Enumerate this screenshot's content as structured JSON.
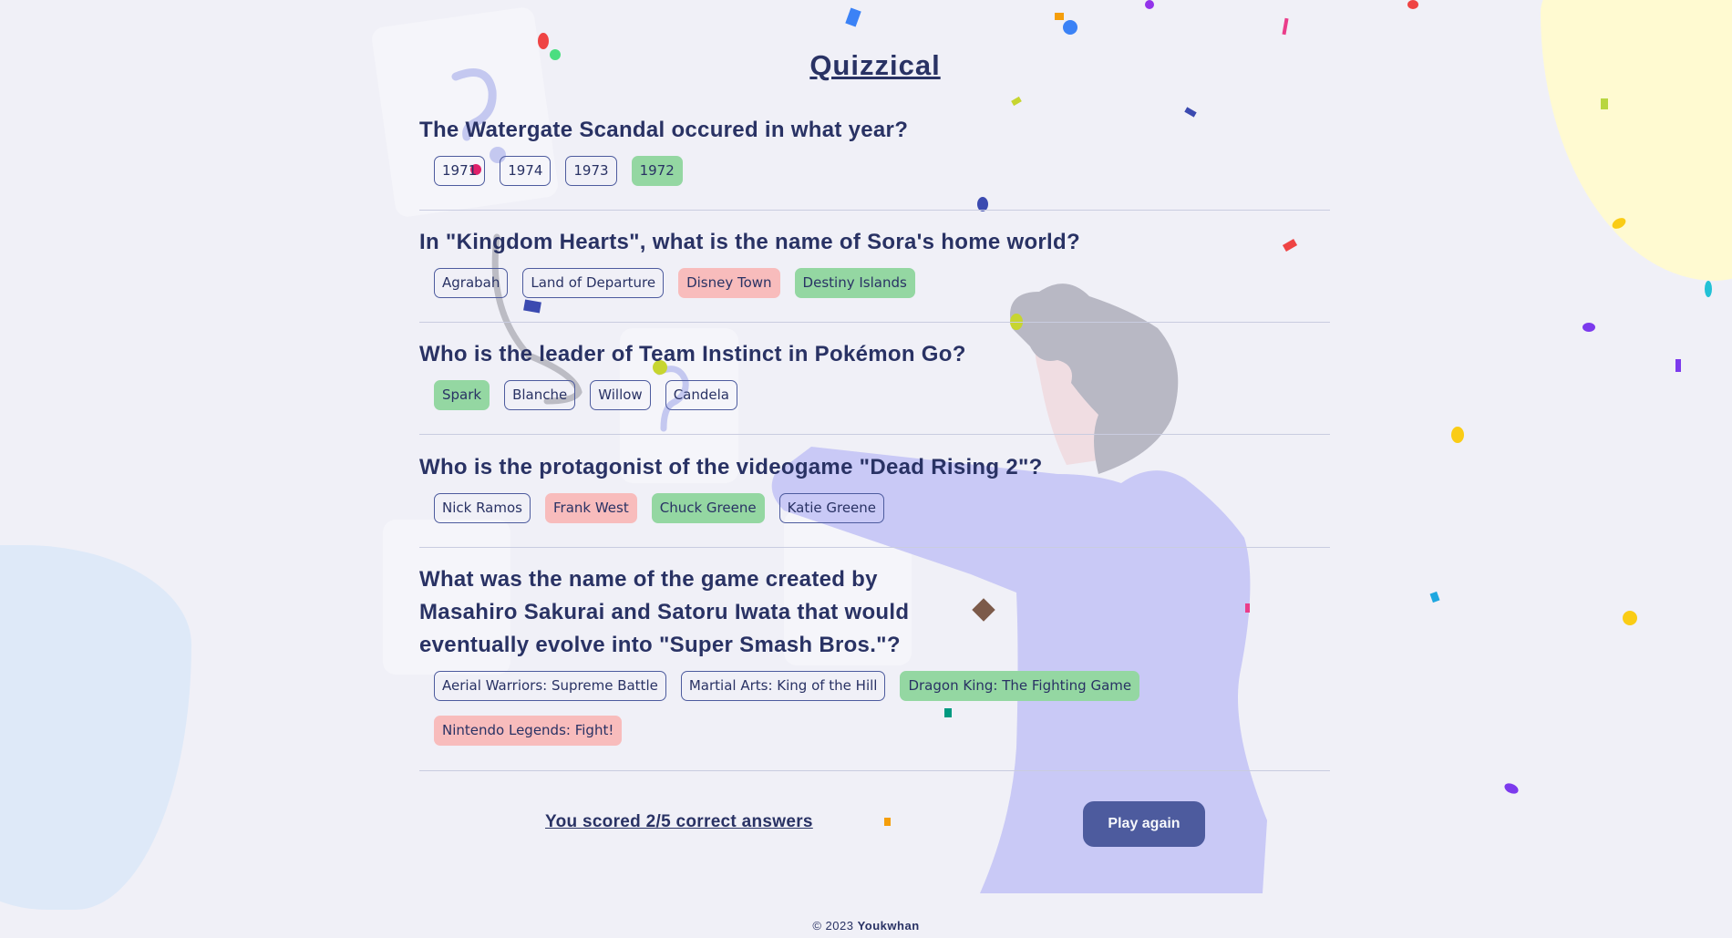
{
  "app": {
    "title": "Quizzical"
  },
  "questions": [
    {
      "text": "The Watergate Scandal occured in what year?",
      "answers": [
        {
          "label": "1971",
          "state": "none"
        },
        {
          "label": "1974",
          "state": "none"
        },
        {
          "label": "1973",
          "state": "none"
        },
        {
          "label": "1972",
          "state": "correct"
        }
      ]
    },
    {
      "text": "In \"Kingdom Hearts\", what is the name of Sora's home world?",
      "answers": [
        {
          "label": "Agrabah",
          "state": "none"
        },
        {
          "label": "Land of Departure",
          "state": "none"
        },
        {
          "label": "Disney Town",
          "state": "wrong"
        },
        {
          "label": "Destiny Islands",
          "state": "correct"
        }
      ]
    },
    {
      "text": "Who is the leader of Team Instinct in Pokémon Go?",
      "answers": [
        {
          "label": "Spark",
          "state": "correct"
        },
        {
          "label": "Blanche",
          "state": "none"
        },
        {
          "label": "Willow",
          "state": "none"
        },
        {
          "label": "Candela",
          "state": "none"
        }
      ]
    },
    {
      "text": "Who is the protagonist of the videogame \"Dead Rising 2\"?",
      "answers": [
        {
          "label": "Nick Ramos",
          "state": "none"
        },
        {
          "label": "Frank West",
          "state": "wrong"
        },
        {
          "label": "Chuck Greene",
          "state": "correct"
        },
        {
          "label": "Katie Greene",
          "state": "none"
        }
      ]
    },
    {
      "text": "What was the name of the game created by Masahiro Sakurai and Satoru Iwata that would eventually evolve into \"Super Smash Bros.\"?",
      "answers": [
        {
          "label": "Aerial Warriors: Supreme Battle",
          "state": "none"
        },
        {
          "label": "Martial Arts: King of the Hill",
          "state": "none"
        },
        {
          "label": "Dragon King: The Fighting Game",
          "state": "correct"
        },
        {
          "label": "Nintendo Legends: Fight!",
          "state": "wrong"
        }
      ]
    }
  ],
  "result": {
    "score_text": "You scored 2/5 correct answers",
    "play_again_label": "Play again"
  },
  "footer": {
    "copyright": "© 2023",
    "author": "Youkwhan"
  },
  "colors": {
    "text": "#293264",
    "button": "#4d5b9e",
    "correct": "#94d7a2",
    "wrong": "#f8bcbc",
    "background": "#f0f0f7",
    "blob_yellow": "#fffad1",
    "blob_blue": "#dee9f8"
  },
  "icons": [
    "question-mark-icon",
    "person-illustration",
    "confetti"
  ]
}
